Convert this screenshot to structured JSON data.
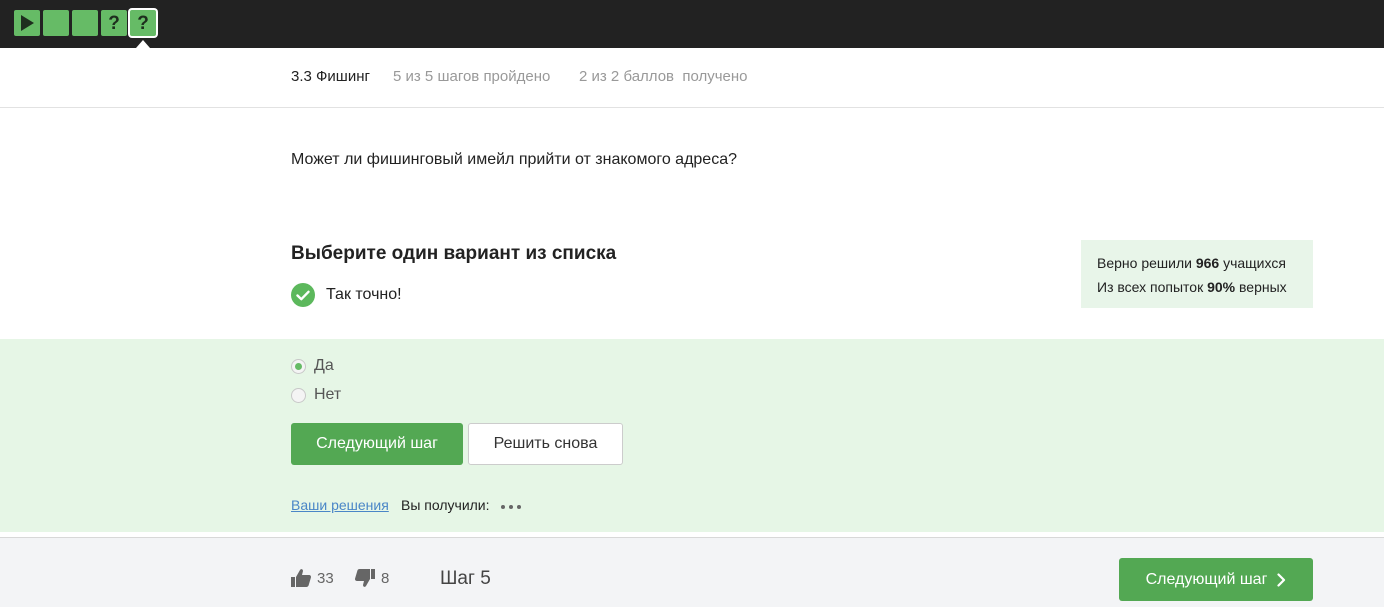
{
  "top_nav": {
    "steps": [
      {
        "kind": "video",
        "icon": "play-icon"
      },
      {
        "kind": "text",
        "icon": ""
      },
      {
        "kind": "text",
        "icon": ""
      },
      {
        "kind": "quiz",
        "icon": "question-icon",
        "glyph": "?"
      },
      {
        "kind": "quiz",
        "icon": "question-icon",
        "glyph": "?",
        "active": true
      }
    ]
  },
  "lesson": {
    "title": "3.3 Фишинг",
    "steps_progress": "5 из 5 шагов пройдено",
    "score": "2 из 2 баллов  получено"
  },
  "question": {
    "text": "Может ли фишинговый имейл прийти от знакомого адреса?"
  },
  "quiz": {
    "instruction": "Выберите один вариант из списка",
    "feedback": "Так точно!",
    "options": [
      {
        "label": "Да",
        "selected": true
      },
      {
        "label": "Нет",
        "selected": false
      }
    ],
    "next_button": "Следующий шаг",
    "retry_button": "Решить снова",
    "solutions_link": "Ваши решения",
    "received_label": "Вы получили:"
  },
  "stats": {
    "line1_prefix": "Верно решили ",
    "solved_count": "966",
    "line1_suffix": " учащихся",
    "line2_prefix": "Из всех попыток ",
    "percent": "90%",
    "line2_suffix": " верных"
  },
  "footer": {
    "likes": "33",
    "dislikes": "8",
    "step_label": "Шаг 5",
    "next_button": "Следующий шаг"
  },
  "colors": {
    "accent": "#53a853",
    "step_tile": "#66bb66",
    "answer_bg": "#e6f6e6",
    "topbar": "#222222"
  }
}
